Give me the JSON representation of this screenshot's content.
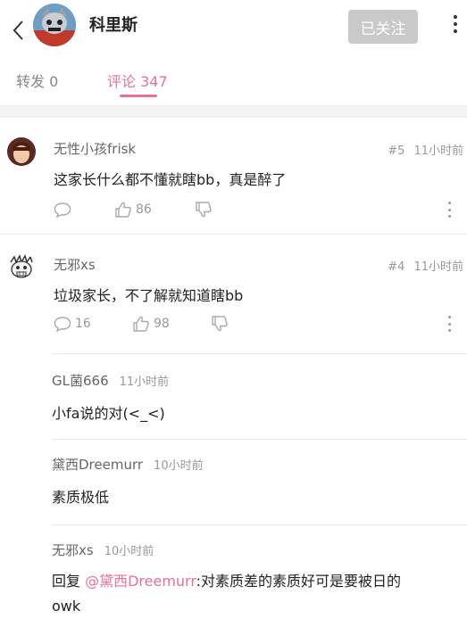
{
  "header": {
    "title": "科里斯",
    "follow_label": "已关注"
  },
  "tabs": {
    "repost": "转发 0",
    "comments": "评论 347"
  },
  "comments": [
    {
      "name": "无性小孩frisk",
      "floor": "#5",
      "time": "11小时前",
      "text": "这家长什么都不懂就瞎bb，真是醉了",
      "reply_count": "",
      "like_count": "86"
    },
    {
      "name": "无邪xs",
      "floor": "#4",
      "time": "11小时前",
      "text": "垃圾家长，不了解就知道瞎bb",
      "reply_count": "16",
      "like_count": "98"
    }
  ],
  "replies": [
    {
      "name": "GL菌666",
      "time": "11小时前",
      "text": "小fa说的对(<_<)"
    },
    {
      "name": "黛西Dreemurr",
      "time": "10小时前",
      "text": "素质极低"
    },
    {
      "name": "无邪xs",
      "time": "10小时前",
      "prefix": "回复 ",
      "mention": "@黛西Dreemurr",
      "text": ":对素质差的素质好可是要被日的",
      "text_line2": "owk"
    }
  ],
  "icons": {
    "back": "chevron-left-icon",
    "more": "more-vertical-icon",
    "comment": "comment-bubble-icon",
    "like": "thumbs-up-icon",
    "dislike": "thumbs-down-icon"
  },
  "colors": {
    "accent": "#e86f9d",
    "follow_bg": "#c9c9c9",
    "muted": "#999999"
  }
}
